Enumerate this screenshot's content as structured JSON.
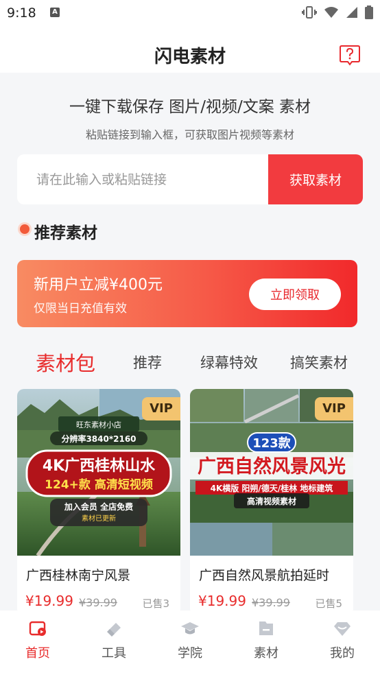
{
  "status_bar": {
    "time": "9:18",
    "notification_icon": "a-icon"
  },
  "header": {
    "title": "闪电素材",
    "help_icon": "help-icon"
  },
  "hero": {
    "title": "一键下载保存 图片/视频/文案 素材",
    "subtitle": "粘贴链接到输入框，可获取图片视频等素材"
  },
  "search": {
    "placeholder": "请在此输入或粘贴链接",
    "value": "",
    "button_label": "获取素材"
  },
  "recommend": {
    "title": "推荐素材"
  },
  "promo": {
    "title": "新用户立减¥400元",
    "subtitle": "仅限当日充值有效",
    "button_label": "立即领取"
  },
  "tabs": [
    {
      "label": "素材包",
      "active": true
    },
    {
      "label": "推荐",
      "active": false
    },
    {
      "label": "绿幕特效",
      "active": false
    },
    {
      "label": "搞笑素材",
      "active": false
    }
  ],
  "products": [
    {
      "name": "广西桂林南宁风景",
      "price": "¥19.99",
      "original_price": "¥39.99",
      "sold": "已售3",
      "badge": "VIP",
      "thumb_text": {
        "shop": "旺东素材小店",
        "resolution": "分辨率3840*2160",
        "headline": "4K广西桂林山水",
        "sub": "124+款 高清短视频",
        "member": "加入会员 全店免费",
        "update": "素材已更新"
      }
    },
    {
      "name": "广西自然风景航拍延时",
      "price": "¥19.99",
      "original_price": "¥39.99",
      "sold": "已售5",
      "badge": "VIP",
      "thumb_text": {
        "count": "123款",
        "headline": "广西自然风景风光",
        "sub": "4K横版 阳朔/德天/桂林 地标建筑",
        "caption": "高清视频素材"
      }
    }
  ],
  "tab_bar": [
    {
      "label": "首页",
      "icon": "home-icon",
      "active": true
    },
    {
      "label": "工具",
      "icon": "eraser-tool-icon",
      "active": false
    },
    {
      "label": "学院",
      "icon": "graduation-cap-icon",
      "active": false
    },
    {
      "label": "素材",
      "icon": "folder-icon",
      "active": false
    },
    {
      "label": "我的",
      "icon": "diamond-user-icon",
      "active": false
    }
  ],
  "colors": {
    "accent": "#e82c2c",
    "promo_start": "#f88b62",
    "promo_end": "#f1292b",
    "vip": "#f3c46f"
  }
}
